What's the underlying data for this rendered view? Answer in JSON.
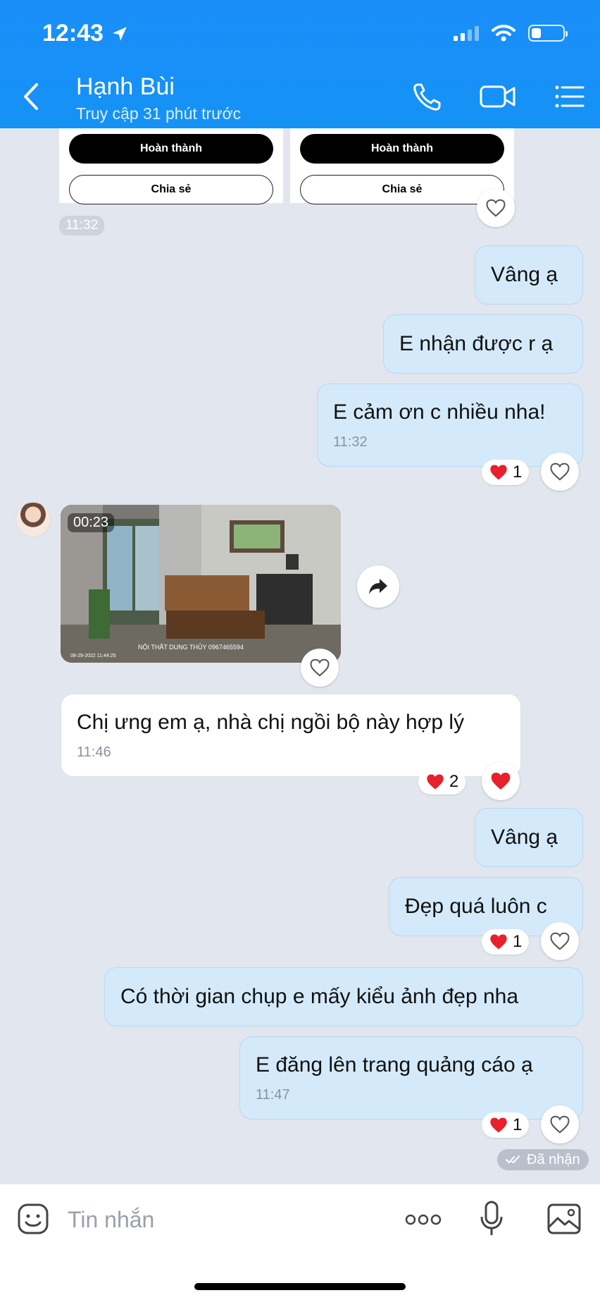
{
  "status_bar": {
    "time": "12:43"
  },
  "header": {
    "contact_name": "Hạnh Bùi",
    "contact_status": "Truy cập 31 phút trước",
    "icons": [
      "back-icon",
      "phone-icon",
      "video-call-icon",
      "menu-icon"
    ]
  },
  "cards": [
    {
      "done_label": "Hoàn thành",
      "share_label": "Chia sẻ"
    },
    {
      "done_label": "Hoàn thành",
      "share_label": "Chia sẻ"
    }
  ],
  "messages": {
    "cards_time": "11:32",
    "m1": {
      "text": "Vâng ạ"
    },
    "m2": {
      "text": "E nhận được r ạ"
    },
    "m3": {
      "text": "E cảm ơn c nhiều nha!",
      "time": "11:32",
      "reaction_count": "1"
    },
    "video": {
      "duration": "00:23",
      "watermark": "NỘI THẤT DUNG THỦY 0967465594",
      "date_stamp": "08-29-2022 11:44:25"
    },
    "m4": {
      "text": "Chị ưng em ạ, nhà chị ngồi bộ này hợp lý",
      "time": "11:46",
      "reaction_count": "2"
    },
    "m5": {
      "text": "Vâng ạ"
    },
    "m6": {
      "text": "Đẹp quá luôn c",
      "reaction_count": "1"
    },
    "m7": {
      "text": "Có thời gian chụp e mấy kiểu ảnh đẹp nha"
    },
    "m8": {
      "text": "E đăng lên trang quảng cáo ạ",
      "time": "11:47",
      "reaction_count": "1"
    },
    "received_status": "Đã nhận"
  },
  "input": {
    "placeholder": "Tin nhắn",
    "icons": [
      "sticker-icon",
      "more-icon",
      "microphone-icon",
      "image-icon"
    ]
  },
  "colors": {
    "header": "#1a8ef8",
    "my_bubble": "#d4eafa",
    "background": "#e2e6ee",
    "heart": "#e8202c"
  }
}
